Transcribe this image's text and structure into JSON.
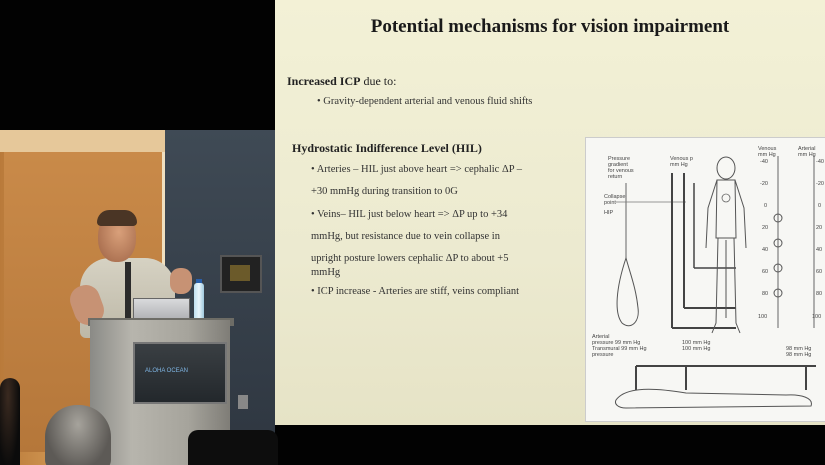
{
  "slide": {
    "title": "Potential mechanisms for vision impairment",
    "icp_heading_bold": "Increased ICP",
    "icp_heading_rest": " due to:",
    "icp_bullets": [
      "• Gravity-dependent arterial and venous fluid shifts"
    ],
    "hil_heading": "Hydrostatic Indifference Level (HIL)",
    "hil_lines": [
      "• Arteries – HIL just above heart => cephalic ΔP –",
      "+30 mmHg during transition to 0G",
      "• Veins– HIL just below heart => ΔP up to +34",
      "mmHg, but resistance due to vein collapse in",
      "upright posture lowers cephalic ΔP to about +5",
      "mmHg",
      "• ICP increase - Arteries are stiff, veins compliant"
    ]
  },
  "figure": {
    "left_labels": [
      "Pressure",
      "gradient",
      "for venous",
      "return",
      "Collapse",
      "point",
      "HIP"
    ],
    "top_labels": [
      "Venous p",
      "mm Hg"
    ],
    "right_labels": [
      "Venous",
      "mm Hg",
      "Arterial",
      "mm Hg"
    ],
    "scale_left": [
      "-40",
      "-20",
      "0",
      "20",
      "40",
      "60",
      "80",
      "100"
    ],
    "scale_right": [
      "-40",
      "-20",
      "0",
      "20",
      "40",
      "60",
      "80",
      "100"
    ],
    "bottom_left": [
      "Arterial",
      "pressure 99 mm Hg",
      "Transmural 99 mm Hg",
      "pressure"
    ],
    "bottom_mid": [
      "100 mm Hg",
      "100 mm Hg"
    ],
    "bottom_right": [
      "98 mm Hg",
      "98 mm Hg"
    ]
  },
  "podium_sign": "ALOHA OCEAN"
}
